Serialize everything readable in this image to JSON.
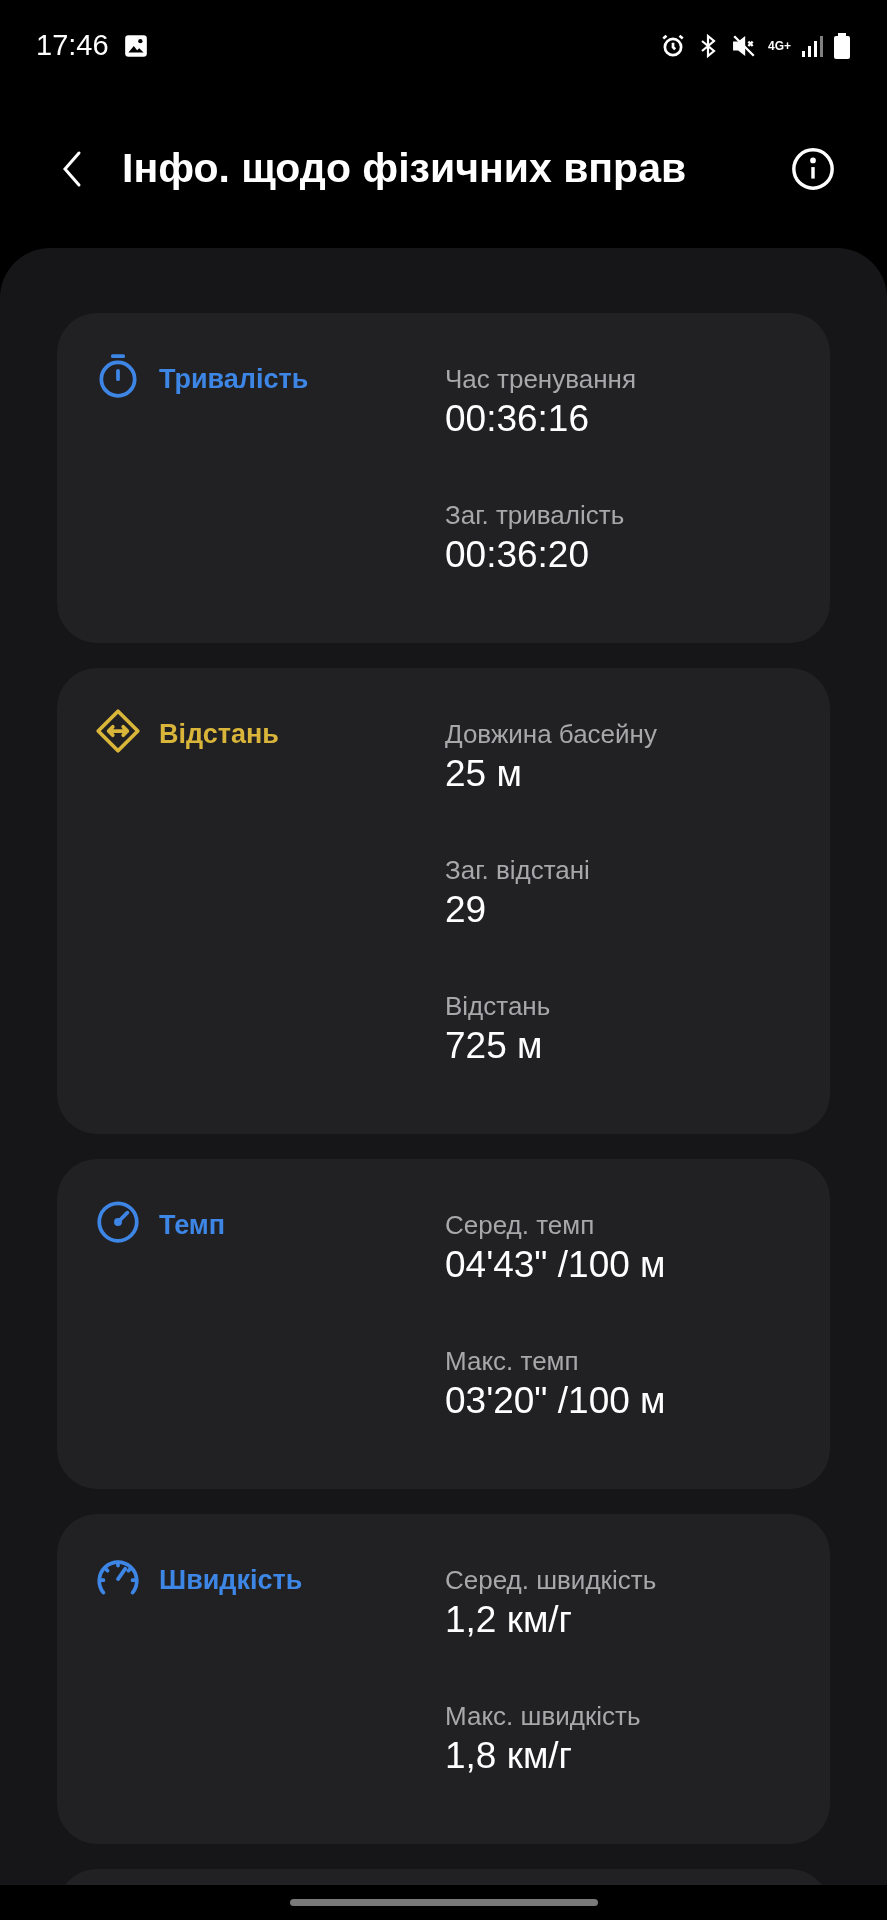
{
  "status_bar": {
    "time": "17:46",
    "network": "4G+"
  },
  "header": {
    "title": "Інфо. щодо фізичних вправ"
  },
  "sections": [
    {
      "kind": "duration",
      "title": "Тривалість",
      "color": "#3d86e6",
      "metrics": [
        {
          "label": "Час тренування",
          "value": "00:36:16"
        },
        {
          "label": "Заг. тривалість",
          "value": "00:36:20"
        }
      ]
    },
    {
      "kind": "distance",
      "title": "Відстань",
      "color": "#d9b53a",
      "metrics": [
        {
          "label": "Довжина басейну",
          "value": "25 м"
        },
        {
          "label": "Заг. відстані",
          "value": "29"
        },
        {
          "label": "Відстань",
          "value": "725 м"
        }
      ]
    },
    {
      "kind": "pace",
      "title": "Темп",
      "color": "#3d86e6",
      "metrics": [
        {
          "label": "Серед. темп",
          "value": "04'43\" /100 м"
        },
        {
          "label": "Макс. темп",
          "value": "03'20\" /100 м"
        }
      ]
    },
    {
      "kind": "speed",
      "title": "Швидкість",
      "color": "#3d86e6",
      "metrics": [
        {
          "label": "Серед. швидкість",
          "value": "1,2 км/г"
        },
        {
          "label": "Макс. швидкість",
          "value": "1,8 км/г"
        }
      ]
    }
  ]
}
